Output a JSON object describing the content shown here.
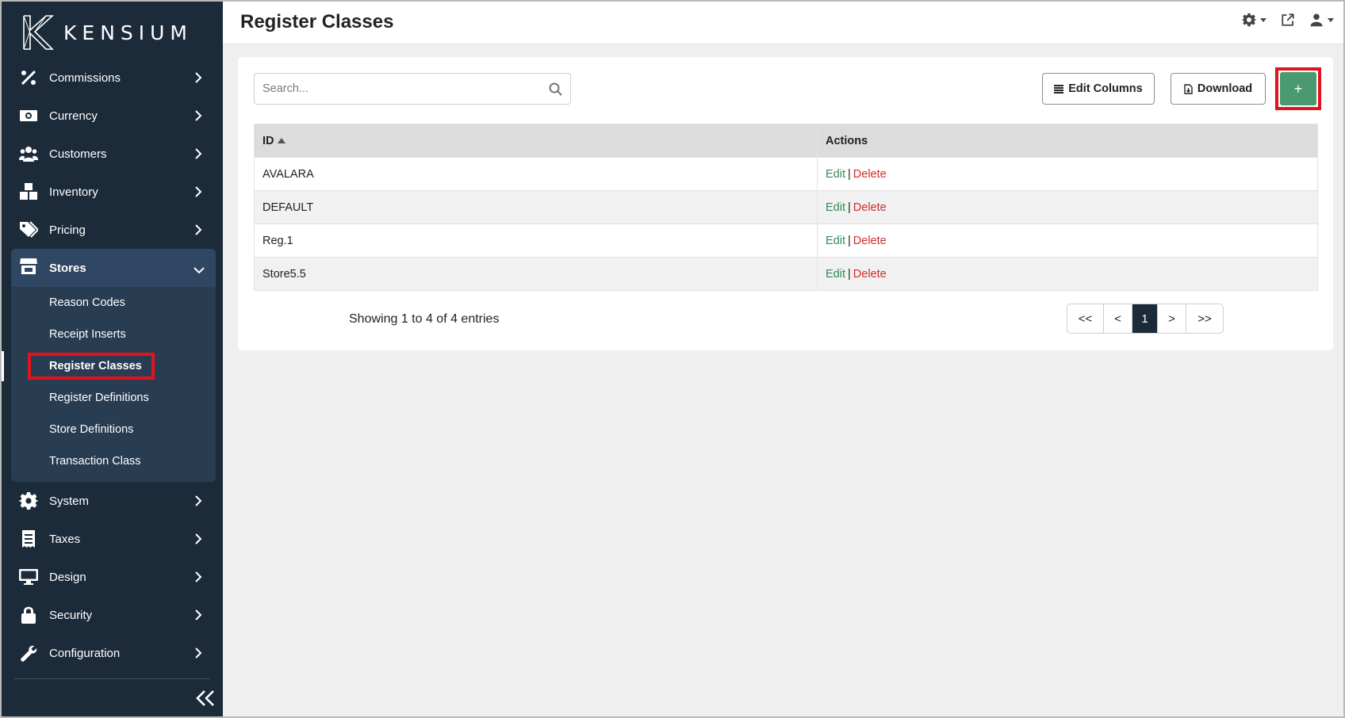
{
  "brand": {
    "name": "KENSIUM"
  },
  "header": {
    "title": "Register Classes"
  },
  "sidebar": {
    "items_top": [
      {
        "label": "Commissions",
        "icon": "percent-icon"
      },
      {
        "label": "Currency",
        "icon": "money-bill-icon"
      },
      {
        "label": "Customers",
        "icon": "users-icon"
      },
      {
        "label": "Inventory",
        "icon": "boxes-icon"
      },
      {
        "label": "Pricing",
        "icon": "tags-icon"
      }
    ],
    "stores": {
      "label": "Stores",
      "subitems": [
        {
          "label": "Reason Codes"
        },
        {
          "label": "Receipt Inserts"
        },
        {
          "label": "Register Classes"
        },
        {
          "label": "Register Definitions"
        },
        {
          "label": "Store Definitions"
        },
        {
          "label": "Transaction Class"
        }
      ]
    },
    "items_bottom": [
      {
        "label": "System",
        "icon": "gear-icon"
      },
      {
        "label": "Taxes",
        "icon": "receipt-icon"
      },
      {
        "label": "Design",
        "icon": "monitor-icon"
      },
      {
        "label": "Security",
        "icon": "lock-icon"
      },
      {
        "label": "Configuration",
        "icon": "wrench-icon"
      }
    ]
  },
  "toolbar": {
    "search_placeholder": "Search...",
    "edit_columns_label": "Edit Columns",
    "download_label": "Download",
    "add_label": "+"
  },
  "table": {
    "columns": [
      "ID",
      "Actions"
    ],
    "rows": [
      {
        "id": "AVALARA"
      },
      {
        "id": "DEFAULT"
      },
      {
        "id": "Reg.1"
      },
      {
        "id": "Store5.5"
      }
    ],
    "edit_label": "Edit",
    "separator": "|",
    "delete_label": "Delete"
  },
  "footer": {
    "info": "Showing 1 to 4 of 4 entries",
    "pager": {
      "first": "<<",
      "prev": "<",
      "current": "1",
      "next": ">",
      "last": ">>"
    }
  },
  "colors": {
    "sidebar_bg": "#1c2b3a",
    "accent_green": "#4a9a70",
    "highlight_red": "#e0131e",
    "delete_red": "#d22b2b",
    "edit_green": "#2e8b57"
  }
}
